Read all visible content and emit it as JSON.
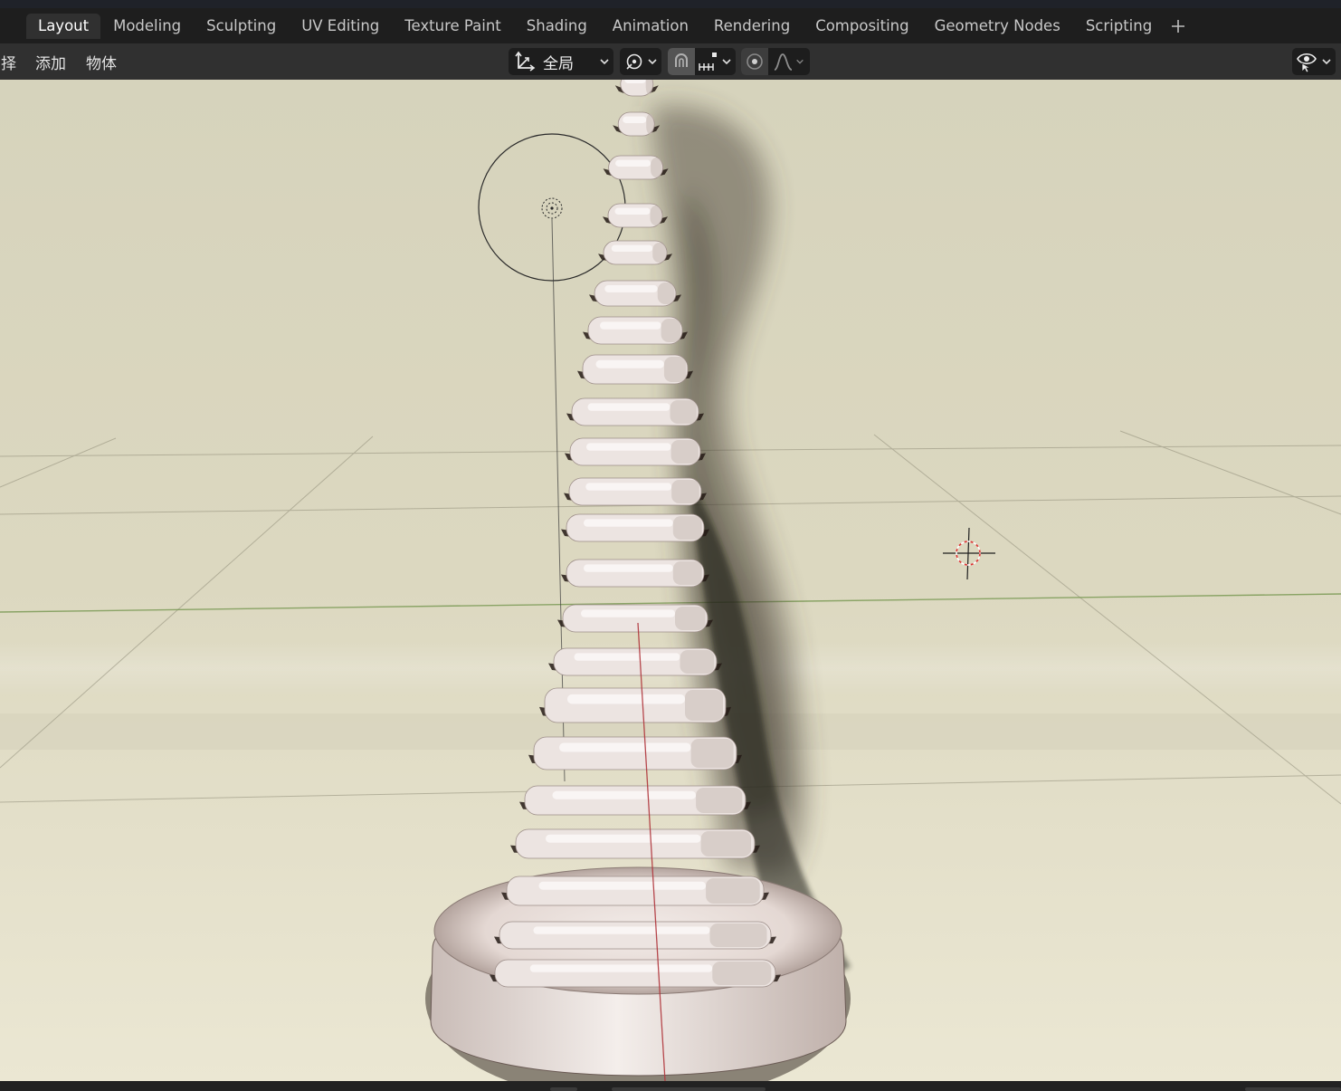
{
  "workspace_tabs": [
    {
      "label": "Layout",
      "active": true
    },
    {
      "label": "Modeling"
    },
    {
      "label": "Sculpting"
    },
    {
      "label": "UV Editing"
    },
    {
      "label": "Texture Paint"
    },
    {
      "label": "Shading"
    },
    {
      "label": "Animation"
    },
    {
      "label": "Rendering"
    },
    {
      "label": "Compositing"
    },
    {
      "label": "Geometry Nodes"
    },
    {
      "label": "Scripting"
    }
  ],
  "add_workspace_icon": "plus-icon",
  "viewport_menu": [
    "择",
    "添加",
    "物体"
  ],
  "header": {
    "transform_orientation": "全局",
    "icons": [
      "transform-orientation-icon",
      "pivot-point-icon",
      "snap-magnet-icon",
      "snap-increment-icon",
      "proportional-editing-icon",
      "falloff-curve-icon",
      "visibility-eye-icon"
    ]
  },
  "colors": {
    "accent_active_tab": "#303030",
    "header_bg": "#303030",
    "x_axis": "#b0363c",
    "y_axis": "#7b9a55",
    "viewport_bg": "#e3e0c9"
  }
}
